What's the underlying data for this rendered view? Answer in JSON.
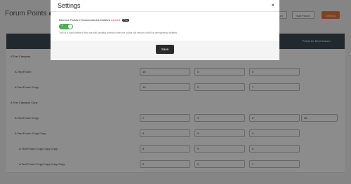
{
  "page": {
    "title": "Forum Points",
    "badge": "Pro",
    "buttons": [
      "Add Forum",
      "Sub Forum",
      "Settings"
    ]
  },
  "table": {
    "header_right": "Points for Best Answer",
    "rows": [
      {
        "label": "A Test Category",
        "values": []
      },
      {
        "label": "A Test Forum",
        "values": [
          "10",
          "0",
          "0",
          ""
        ]
      },
      {
        "label": "A Test Forum Copy",
        "values": [
          "10",
          "0",
          "7",
          ""
        ]
      },
      {
        "label": "A Test Category Copy",
        "values": []
      },
      {
        "label": "A Test Forum Copy",
        "values": [
          "2",
          "9",
          "0",
          "25"
        ]
      },
      {
        "label": "A Test Forum Copy Copy",
        "values": [
          "9",
          "9",
          "9",
          ""
        ]
      },
      {
        "label": "A Test Forum Copy Copy Copy",
        "values": [
          "9",
          "9",
          "0",
          ""
        ]
      },
      {
        "label": "A Test Forum Copy Copy Copy Copy",
        "values": [
          "0",
          "0",
          "7",
          ""
        ]
      }
    ]
  },
  "modal": {
    "title": "Settings",
    "close_symbol": "×",
    "option_label": "Remove Points If Comments Are Deleted",
    "option_expired": "expired",
    "option_badge": "Pro",
    "toggle_on": true,
    "help_text": "This is a hard delete if they are still pending deletion then the points will remain until it is permanently deleted",
    "save_label": "Save"
  },
  "colors": {
    "overlay": "#000000",
    "toggle": "#4caf50",
    "header_dark": "#3f4b55",
    "accent_orange": "#e27a3c"
  }
}
